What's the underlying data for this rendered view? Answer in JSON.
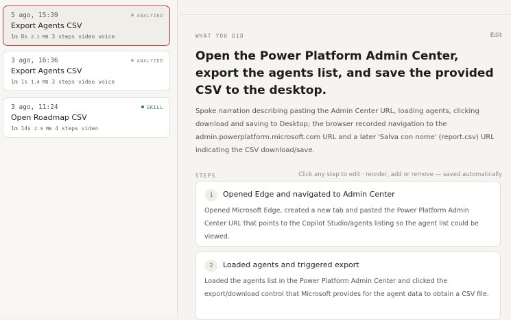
{
  "sidebar": {
    "items": [
      {
        "date": "5 ago, 15:39",
        "badge": "ANALYZED",
        "title": "Export Agents CSV",
        "duration": "1m 8s",
        "size": "2.1 MB",
        "steps": "3 steps",
        "tag1": "video",
        "tag2": "voice",
        "selected": true
      },
      {
        "date": "3 ago, 16:36",
        "badge": "ANALYZED",
        "title": "Export Agents CSV",
        "duration": "1m 1s",
        "size": "1.4 MB",
        "steps": "3 steps",
        "tag1": "video",
        "tag2": "voice",
        "selected": false
      },
      {
        "date": "3 ago, 11:24",
        "badge": "SKILL",
        "title": "Open Roadmap CSV",
        "duration": "1m 14s",
        "size": "2.9 MB",
        "steps": "4 steps",
        "tag1": "video",
        "tag2": "",
        "selected": false
      }
    ]
  },
  "main": {
    "section_label": "WHAT YOU DID",
    "edit_label": "Edit",
    "headline": "Open the Power Platform Admin Center, export the agents list, and save the provided CSV to the desktop.",
    "description": "Spoke narration describing pasting the Admin Center URL, loading agents, clicking download and saving to Desktop; the browser recorded navigation to the admin.powerplatform.microsoft.com URL and a later 'Salva con nome' (report.csv) URL indicating the CSV download/save.",
    "steps_label": "STEPS",
    "steps_hint": "Click any step to edit · reorder, add or remove — saved automatically",
    "steps": [
      {
        "number": "1",
        "title": "Opened Edge and navigated to Admin Center",
        "description": "Opened Microsoft Edge, created a new tab and pasted the Power Platform Admin Center URL that points to the Copilot Studio/agents listing so the agent list could be viewed."
      },
      {
        "number": "2",
        "title": "Loaded agents and triggered export",
        "description": "Loaded the agents list in the Power Platform Admin Center and clicked the export/download control that Microsoft provides for the agent data to obtain a CSV file."
      }
    ]
  }
}
